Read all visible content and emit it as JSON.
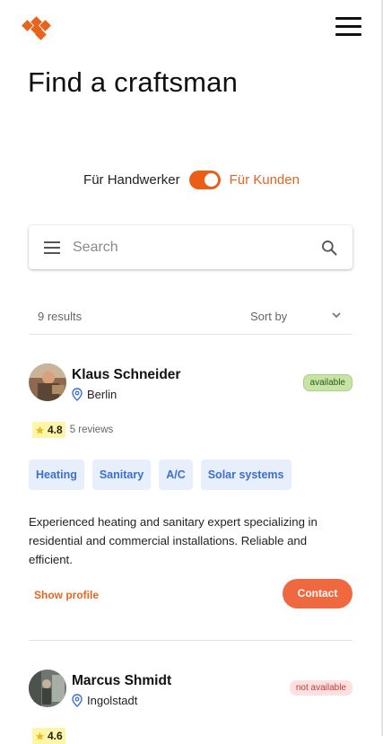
{
  "header": {
    "logo_icon": "diamond-logo-icon",
    "menu_icon": "hamburger-icon"
  },
  "page": {
    "title": "Find a craftsman"
  },
  "toggle": {
    "left_label": "Für Handwerker",
    "right_label": "Für Kunden",
    "state": "on",
    "accent": "#ea5f15"
  },
  "search": {
    "placeholder": "Search",
    "value": "",
    "menu_icon": "hamburger-icon",
    "search_icon": "search-icon"
  },
  "results": {
    "count_label": "9 results",
    "sort_label": "Sort by"
  },
  "craftsmen": [
    {
      "name": "Klaus Schneider",
      "location": "Berlin",
      "status": "available",
      "rating": "4.8",
      "reviews": "5 reviews",
      "tags": [
        "Heating",
        "Sanitary",
        "A/C",
        "Solar systems"
      ],
      "description": "Experienced heating and sanitary expert specializing in residential and commercial installations. Reliable and efficient.",
      "show_profile": "Show profile",
      "contact": "Contact"
    },
    {
      "name": "Marcus Shmidt",
      "location": "Ingolstadt",
      "status": "not available",
      "rating": "4.6",
      "reviews": ""
    }
  ],
  "colors": {
    "brand": "#e8641d",
    "contact": "#f0683f",
    "tag_bg": "#e7eefc",
    "tag_text": "#3c6fd1"
  }
}
